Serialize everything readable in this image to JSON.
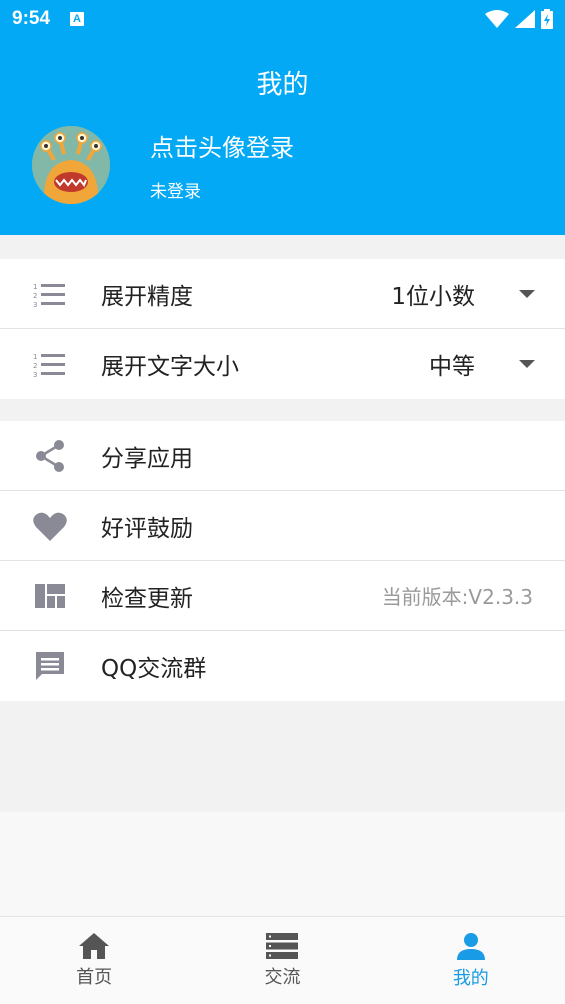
{
  "status_bar": {
    "time": "9:54",
    "notification_icon": "A"
  },
  "header": {
    "title": "我的",
    "login_title": "点击头像登录",
    "login_status": "未登录",
    "background_color": "#03a9f4"
  },
  "settings": [
    {
      "icon": "list-numbered-icon",
      "label": "展开精度",
      "value": "1位小数"
    },
    {
      "icon": "list-numbered-icon",
      "label": "展开文字大小",
      "value": "中等"
    }
  ],
  "actions": [
    {
      "icon": "share-icon",
      "label": "分享应用"
    },
    {
      "icon": "heart-icon",
      "label": "好评鼓励"
    },
    {
      "icon": "dashboard-icon",
      "label": "检查更新",
      "detail": "当前版本:V2.3.3"
    },
    {
      "icon": "chat-icon",
      "label": "QQ交流群"
    }
  ],
  "bottom_nav": [
    {
      "icon": "home-icon",
      "label": "首页",
      "active": false
    },
    {
      "icon": "list-icon",
      "label": "交流",
      "active": false
    },
    {
      "icon": "person-icon",
      "label": "我的",
      "active": true
    }
  ],
  "colors": {
    "accent": "#03a9f4",
    "nav_active": "#1a9be5",
    "icon_gray": "#8a8a96"
  }
}
